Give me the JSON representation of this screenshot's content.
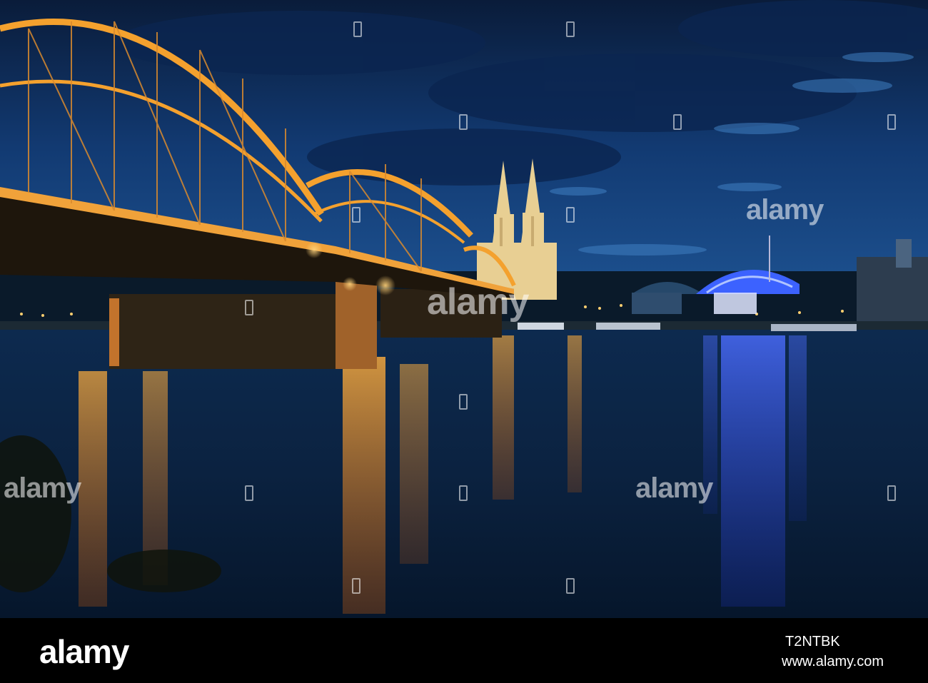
{
  "scene": {
    "subject": "Hohenzollern Bridge, Cologne Cathedral and Musical Dome at dusk over the Rhine",
    "sky_color": "#10366b",
    "bridge_light_color": "#f4a12e",
    "dome_light_color": "#2f58ff"
  },
  "watermark": {
    "text": "alamy"
  },
  "footer": {
    "logo": "alamy",
    "image_id": "T2NTBK",
    "url": "www.alamy.com"
  }
}
